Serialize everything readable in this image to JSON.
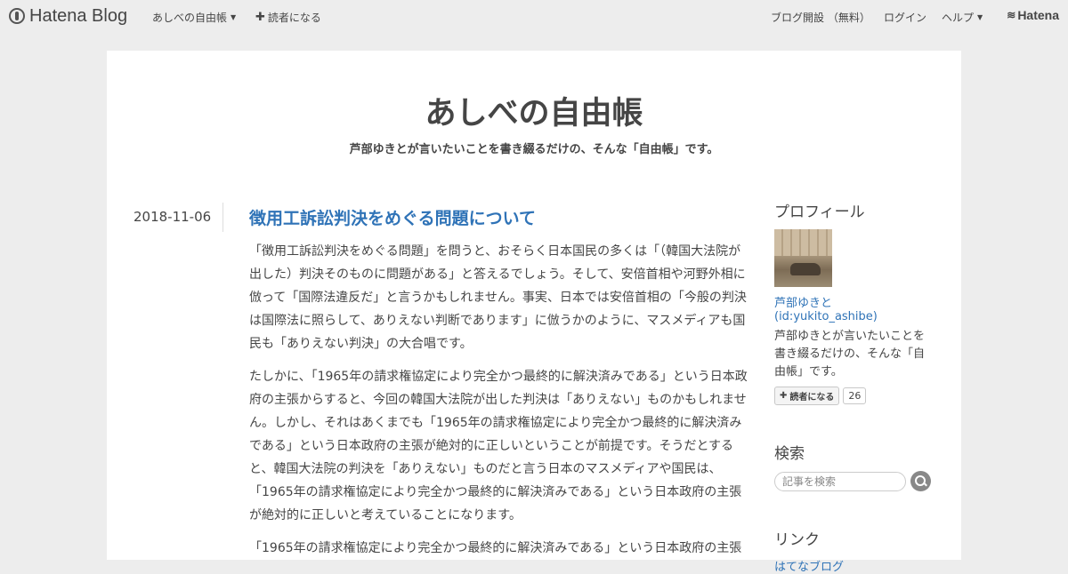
{
  "globalheader": {
    "logo_text": "Hatena Blog",
    "blog_menu_label": "あしべの自由帳",
    "subscribe_label": "読者になる",
    "open_blog_label": "ブログ開設 （無料）",
    "login_label": "ログイン",
    "help_label": "ヘルプ",
    "brand_label": "Hatena"
  },
  "blog": {
    "title": "あしべの自由帳",
    "description": "芦部ゆきとが言いたいことを書き綴るだけの、そんな「自由帳」です。"
  },
  "entry": {
    "date": "2018-11-06",
    "title": "徴用工訴訟判決をめぐる問題について",
    "paragraphs": [
      "「徴用工訴訟判決をめぐる問題」を問うと、おそらく日本国民の多くは「（韓国大法院が出した）判決そのものに問題がある」と答えるでしょう。そして、安倍首相や河野外相に倣って「国際法違反だ」と言うかもしれません。事実、日本では安倍首相の「今般の判決は国際法に照らして、ありえない判断であります」に倣うかのように、マスメディアも国民も「ありえない判決」の大合唱です。",
      "たしかに、「1965年の請求権協定により完全かつ最終的に解決済みである」という日本政府の主張からすると、今回の韓国大法院が出した判決は「ありえない」ものかもしれません。しかし、それはあくまでも「1965年の請求権協定により完全かつ最終的に解決済みである」という日本政府の主張が絶対的に正しいということが前提です。そうだとすると、韓国大法院の判決を「ありえない」ものだと言う日本のマスメディアや国民は、「1965年の請求権協定により完全かつ最終的に解決済みである」という日本政府の主張が絶対的に正しいと考えていることになります。",
      "「1965年の請求権協定により完全かつ最終的に解決済みである」という日本政府の主張"
    ]
  },
  "sidebar": {
    "profile": {
      "heading": "プロフィール",
      "name": "芦部ゆきと (id:yukito_ashibe)",
      "description": "芦部ゆきとが言いたいことを書き綴るだけの、そんな「自由帳」です。",
      "subscribe_label": "読者になる",
      "subscriber_count": "26"
    },
    "search": {
      "heading": "検索",
      "placeholder": "記事を検索"
    },
    "links": {
      "heading": "リンク",
      "items": [
        "はてなブログ"
      ]
    }
  },
  "colors": {
    "link": "#2f73b7",
    "background": "#ededed",
    "text": "#454545"
  }
}
